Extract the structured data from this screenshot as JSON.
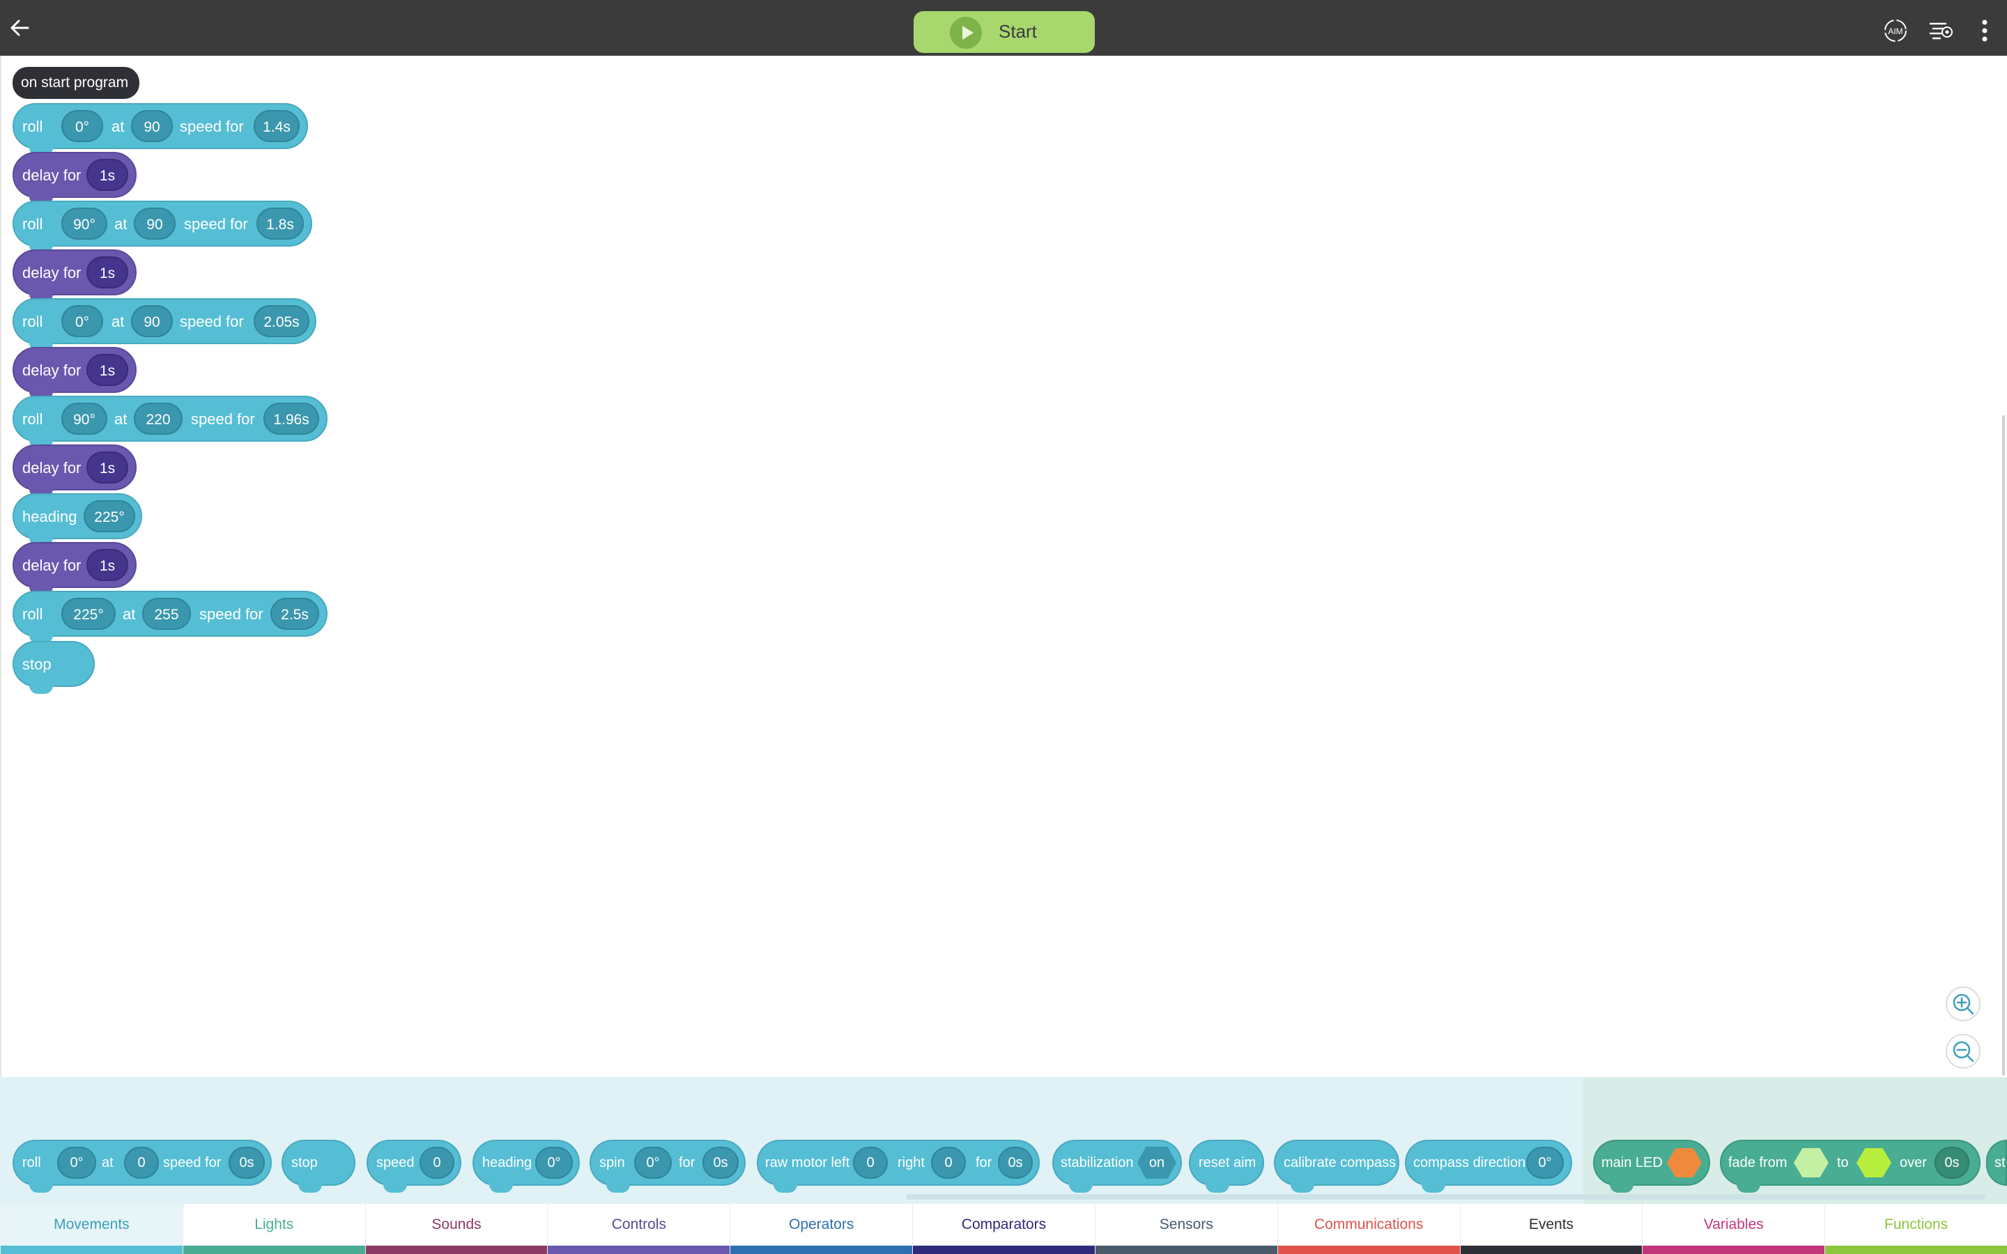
{
  "topbar": {
    "start_label": "Start",
    "back_icon": "arrow-left-icon",
    "aim_icon_label": "AIM",
    "icons": [
      "aim-icon",
      "calibrate-icon",
      "more-vertical-icon"
    ]
  },
  "program": {
    "hat_label": "on start program",
    "blocks": [
      {
        "type": "roll",
        "heading": "0°",
        "at": "at",
        "speed": "90",
        "speed_for": "speed for",
        "duration": "1.4s"
      },
      {
        "type": "delay",
        "label": "delay for",
        "duration": "1s"
      },
      {
        "type": "roll",
        "heading": "90°",
        "at": "at",
        "speed": "90",
        "speed_for": "speed for",
        "duration": "1.8s"
      },
      {
        "type": "delay",
        "label": "delay for",
        "duration": "1s"
      },
      {
        "type": "roll",
        "heading": "0°",
        "at": "at",
        "speed": "90",
        "speed_for": "speed for",
        "duration": "2.05s"
      },
      {
        "type": "delay",
        "label": "delay for",
        "duration": "1s"
      },
      {
        "type": "roll",
        "heading": "90°",
        "at": "at",
        "speed": "220",
        "speed_for": "speed for",
        "duration": "1.96s"
      },
      {
        "type": "delay",
        "label": "delay for",
        "duration": "1s"
      },
      {
        "type": "heading",
        "label": "heading",
        "value": "225°"
      },
      {
        "type": "delay",
        "label": "delay for",
        "duration": "1s"
      },
      {
        "type": "roll",
        "heading": "225°",
        "at": "at",
        "speed": "255",
        "speed_for": "speed for",
        "duration": "2.5s"
      },
      {
        "type": "stop",
        "label": "stop"
      }
    ],
    "roll_label": "roll"
  },
  "palette": {
    "roll": {
      "label": "roll",
      "heading": "0°",
      "at": "at",
      "speed": "0",
      "speed_for": "speed for",
      "duration": "0s"
    },
    "stop": "stop",
    "speed": {
      "label": "speed",
      "value": "0"
    },
    "heading": {
      "label": "heading",
      "value": "0°"
    },
    "spin": {
      "label": "spin",
      "value": "0°",
      "for": "for",
      "duration": "0s"
    },
    "raw_motor": {
      "label": "raw motor left",
      "left": "0",
      "right_label": "right",
      "right": "0",
      "for": "for",
      "duration": "0s"
    },
    "stabilization": {
      "label": "stabilization",
      "value": "on"
    },
    "reset_aim": "reset aim",
    "calibrate_compass": "calibrate compass",
    "compass_direction": {
      "label": "compass direction",
      "value": "0°"
    },
    "main_led": {
      "label": "main LED",
      "color": "#ef8a3c"
    },
    "fade": {
      "label": "fade from",
      "to": "to",
      "over": "over",
      "duration": "0s",
      "from_color": "#c4f0a4",
      "to_color": "#b7ef3c"
    },
    "partial_label": "st"
  },
  "tabs": [
    {
      "label": "Movements",
      "color": "#3aa0b8",
      "bar": "#55bed4"
    },
    {
      "label": "Lights",
      "color": "#49ad93",
      "bar": "#49ad93"
    },
    {
      "label": "Sounds",
      "color": "#8b3a63",
      "bar": "#8b3a63"
    },
    {
      "label": "Controls",
      "color": "#5a4999",
      "bar": "#6a58ae"
    },
    {
      "label": "Operators",
      "color": "#2e6fb0",
      "bar": "#2e6fb0"
    },
    {
      "label": "Comparators",
      "color": "#2f2a7a",
      "bar": "#2f2a7a"
    },
    {
      "label": "Sensors",
      "color": "#4a5a6a",
      "bar": "#4a5a6a"
    },
    {
      "label": "Communications",
      "color": "#d9534f",
      "bar": "#e0534d"
    },
    {
      "label": "Events",
      "color": "#2f2f36",
      "bar": "#2f2f36"
    },
    {
      "label": "Variables",
      "color": "#c2367a",
      "bar": "#c2367a"
    },
    {
      "label": "Functions",
      "color": "#8cc63f",
      "bar": "#8cc63f"
    }
  ],
  "zoom": {
    "in_icon": "zoom-in-icon",
    "out_icon": "zoom-out-icon"
  }
}
